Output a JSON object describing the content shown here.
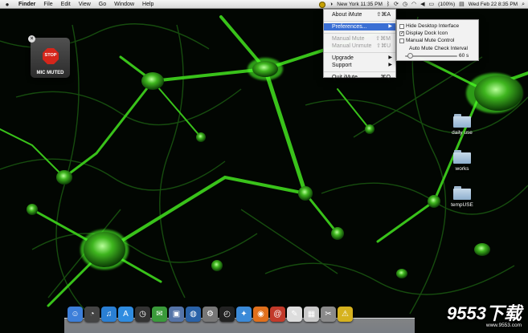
{
  "menubar": {
    "apple": "",
    "app_name": "Finder",
    "items": [
      "File",
      "Edit",
      "View",
      "Go",
      "Window",
      "Help"
    ],
    "clock_location": "New York 11:35 PM",
    "battery": "(100%)",
    "datetime": "Wed Feb 22  8:35 PM"
  },
  "imute_menu": {
    "about": "About iMute",
    "about_shortcut": "⇧⌘A",
    "preferences": "Preferences...",
    "manual_mute": "Manual Mute",
    "manual_mute_shortcut": "⇧⌘M",
    "manual_unmute": "Manual Unmute",
    "manual_unmute_shortcut": "⇧⌘U",
    "upgrade": "Upgrade",
    "support": "Support",
    "quit": "Quit iMute",
    "quit_shortcut": "⌘Q"
  },
  "preferences_panel": {
    "options": [
      {
        "label": "Hide Desktop Interface",
        "checked": false
      },
      {
        "label": "Display Dock Icon",
        "checked": true
      },
      {
        "label": "Manual Mute Control",
        "checked": false
      }
    ],
    "slider_label": "Auto Mute Check Interval",
    "slider_value": "60 s",
    "slider_fraction": 0.05
  },
  "widget": {
    "stop_text": "STOP",
    "label": "MIC MUTED"
  },
  "desktop_folders": [
    "daily use",
    "works",
    "tempUSE"
  ],
  "dock_icons": [
    {
      "name": "finder-icon",
      "glyph": "☺",
      "color": "#3d7fd9"
    },
    {
      "name": "dashboard-icon",
      "glyph": "◔",
      "color": "#444"
    },
    {
      "name": "itunes-icon",
      "glyph": "♫",
      "color": "#2a7fd4"
    },
    {
      "name": "app-store-icon",
      "glyph": "A",
      "color": "#2f8ce0"
    },
    {
      "name": "time-machine-icon",
      "glyph": "◷",
      "color": "#333"
    },
    {
      "name": "messenger-icon",
      "glyph": "✉",
      "color": "#3a9a3a"
    },
    {
      "name": "preview-icon",
      "glyph": "▣",
      "color": "#5574a8"
    },
    {
      "name": "google-earth-icon",
      "glyph": "◍",
      "color": "#2a62a8"
    },
    {
      "name": "system-preferences-icon",
      "glyph": "⚙",
      "color": "#777"
    },
    {
      "name": "clock-icon",
      "glyph": "◴",
      "color": "#222"
    },
    {
      "name": "safari-icon",
      "glyph": "✦",
      "color": "#3b8ad8"
    },
    {
      "name": "firefox-icon",
      "glyph": "◉",
      "color": "#e0701c"
    },
    {
      "name": "address-book-icon",
      "glyph": "@",
      "color": "#c23a2a"
    },
    {
      "name": "textedit-icon",
      "glyph": "✎",
      "color": "#ddd"
    },
    {
      "name": "ical-icon",
      "glyph": "▦",
      "color": "#c9c9c9"
    },
    {
      "name": "script-editor-icon",
      "glyph": "✂",
      "color": "#8a8a8a"
    },
    {
      "name": "network-icon",
      "glyph": "⚠",
      "color": "#d6b21e"
    }
  ],
  "watermark": {
    "main": "9553下载",
    "sub": "www.9553.com"
  },
  "colors": {
    "menu_highlight": "#3b6fd4",
    "stop_red": "#d5261b",
    "wallpaper_green": "#3cff20"
  }
}
